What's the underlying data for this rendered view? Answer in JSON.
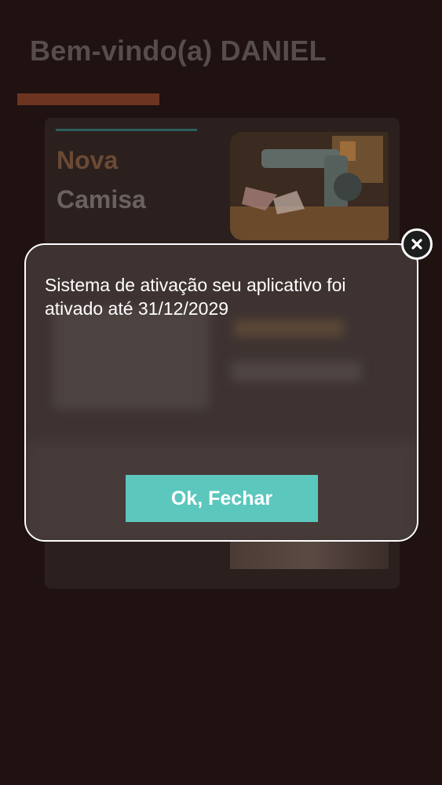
{
  "header": {
    "welcome_text": "Bem-vindo(a) DANIEL"
  },
  "card": {
    "title_line1": "Nova",
    "title_line2": "Camisa",
    "image_icon": "sewing-machine-photo"
  },
  "modal": {
    "message": "Sistema de ativação seu aplicativo foi ativado até 31/12/2029",
    "ok_label": "Ok, Fechar",
    "close_icon": "close-icon"
  },
  "colors": {
    "background": "#1f1210",
    "accent_bar": "#6e3422",
    "button": "#5bc7bd",
    "modal_border": "#ffffff"
  }
}
